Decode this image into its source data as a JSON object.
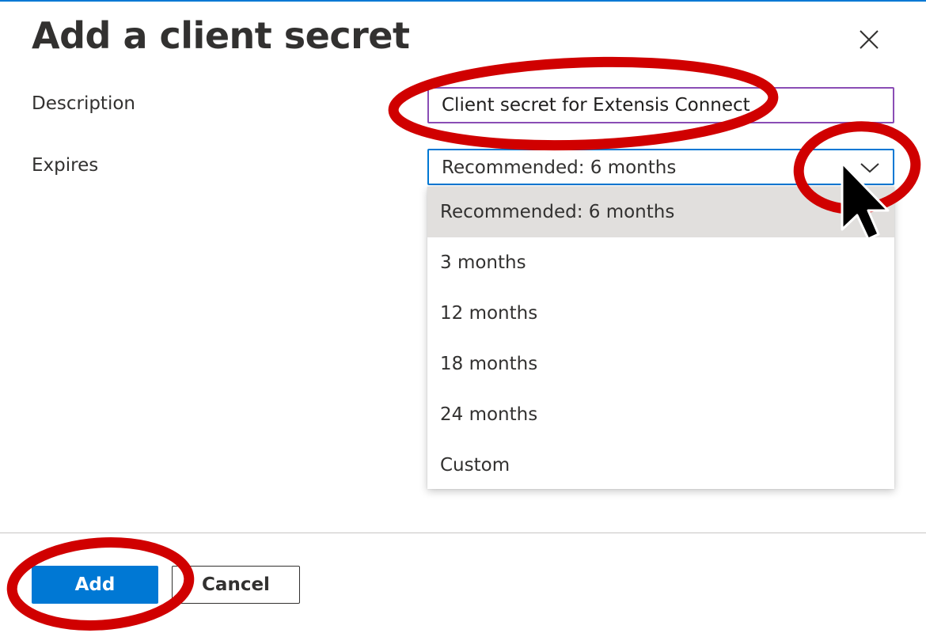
{
  "dialog": {
    "title": "Add a client secret",
    "close_icon": "close-icon"
  },
  "form": {
    "description_label": "Description",
    "description_value": "Client secret for Extensis Connect",
    "expires_label": "Expires",
    "expires_selected": "Recommended: 6 months",
    "expires_options": [
      "Recommended: 6 months",
      "3 months",
      "12 months",
      "18 months",
      "24 months",
      "Custom"
    ]
  },
  "footer": {
    "add_label": "Add",
    "cancel_label": "Cancel"
  },
  "colors": {
    "accent": "#0078d4",
    "annotation": "#d00000",
    "selected_option_bg": "#e1dfdd",
    "input_border": "#8a4db5"
  }
}
